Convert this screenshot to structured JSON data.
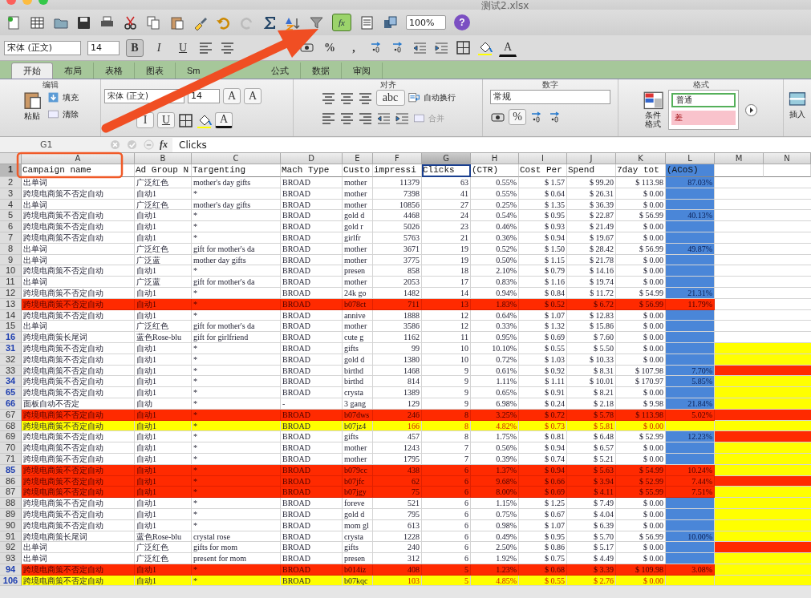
{
  "window": {
    "title": "测试2.xlsx"
  },
  "toolbar": {
    "formula_button": "fx",
    "zoom": "100%",
    "help": "?"
  },
  "format_bar": {
    "font": "宋体 (正文)",
    "size": "14",
    "bold": "B",
    "italic": "I",
    "underline": "U",
    "percent": "%",
    "comma": ",",
    "font_color": "A"
  },
  "ribbon_tabs": [
    {
      "label": "开始",
      "selected": true
    },
    {
      "label": "布局",
      "selected": false
    },
    {
      "label": "表格",
      "selected": false
    },
    {
      "label": "图表",
      "selected": false
    },
    {
      "label": "Sm",
      "selected": false
    },
    {
      "label": "公式",
      "selected": false
    },
    {
      "label": "数据",
      "selected": false
    },
    {
      "label": "审阅",
      "selected": false
    }
  ],
  "ribbon": {
    "edit": {
      "title": "编辑",
      "paste": "粘贴",
      "fill": "填充",
      "clear": "清除"
    },
    "font": {
      "name": "宋体 (正文)",
      "size": "14",
      "grow": "A",
      "shrink": "A",
      "italic": "I",
      "underline": "U",
      "font_color": "A"
    },
    "align": {
      "title": "对齐",
      "orientation": "abc",
      "wrap": "自动换行",
      "merge": "合并"
    },
    "number": {
      "title": "数字",
      "format": "常规",
      "percent": "%"
    },
    "styles": {
      "title": "格式",
      "conditional_1": "条件",
      "conditional_2": "格式",
      "normal": "普通",
      "bad": "差"
    },
    "insert": "插入"
  },
  "formula_bar": {
    "cell": "G1",
    "fx": "fx",
    "value": "Clicks"
  },
  "sheet": {
    "columns": [
      {
        "letter": "A",
        "selected": false
      },
      {
        "letter": "B",
        "selected": false
      },
      {
        "letter": "C",
        "selected": false
      },
      {
        "letter": "D",
        "selected": false
      },
      {
        "letter": "E",
        "selected": false
      },
      {
        "letter": "F",
        "selected": false
      },
      {
        "letter": "G",
        "selected": true
      },
      {
        "letter": "H",
        "selected": false
      },
      {
        "letter": "I",
        "selected": false
      },
      {
        "letter": "J",
        "selected": false
      },
      {
        "letter": "K",
        "selected": false
      },
      {
        "letter": "L",
        "selected": false,
        "color": "#4a86d8"
      },
      {
        "letter": "M",
        "selected": false
      },
      {
        "letter": "N",
        "selected": false
      }
    ],
    "header_row": {
      "number": "1",
      "cells": [
        "Campaign name",
        "Ad Group N",
        "Targenting",
        "Mach Type",
        "Custo",
        "impressi",
        "Clicks",
        "(CTR)",
        "Cost Per",
        "Spend",
        "7day tot",
        "(ACoS)"
      ]
    },
    "rows": [
      {
        "number": "2",
        "number_blue": false,
        "cells": [
          "出单词",
          "广泛红色",
          "mother's day gifts",
          "BROAD",
          "mother",
          "11379",
          "63",
          "0.55%",
          "$ 1.57",
          "$ 99.20",
          "$ 113.98",
          "87.03%"
        ]
      },
      {
        "number": "3",
        "number_blue": false,
        "cells": [
          "跨境电商策不否定自动",
          "自动1",
          "*",
          "BROAD",
          "mother",
          "7398",
          "41",
          "0.55%",
          "$ 0.64",
          "$ 26.31",
          "$ 0.00"
        ]
      },
      {
        "number": "4",
        "number_blue": false,
        "cells": [
          "出单词",
          "广泛红色",
          "mother's day gifts",
          "BROAD",
          "mother",
          "10856",
          "27",
          "0.25%",
          "$ 1.35",
          "$ 36.39",
          "$ 0.00"
        ]
      },
      {
        "number": "5",
        "number_blue": false,
        "cells": [
          "跨境电商策不否定自动",
          "自动1",
          "*",
          "BROAD",
          "gold d",
          "4468",
          "24",
          "0.54%",
          "$ 0.95",
          "$ 22.87",
          "$ 56.99",
          "40.13%"
        ]
      },
      {
        "number": "6",
        "number_blue": false,
        "cells": [
          "跨境电商策不否定自动",
          "自动1",
          "*",
          "BROAD",
          "gold r",
          "5026",
          "23",
          "0.46%",
          "$ 0.93",
          "$ 21.49",
          "$ 0.00"
        ]
      },
      {
        "number": "7",
        "number_blue": false,
        "cells": [
          "跨境电商策不否定自动",
          "自动1",
          "*",
          "BROAD",
          "girlfr",
          "5763",
          "21",
          "0.36%",
          "$ 0.94",
          "$ 19.67",
          "$ 0.00"
        ]
      },
      {
        "number": "8",
        "number_blue": false,
        "cells": [
          "出单词",
          "广泛红色",
          "gift for mother's da",
          "BROAD",
          "mother",
          "3671",
          "19",
          "0.52%",
          "$ 1.50",
          "$ 28.42",
          "$ 56.99",
          "49.87%"
        ]
      },
      {
        "number": "9",
        "number_blue": false,
        "cells": [
          "出单词",
          "广泛蓝",
          "mother day gifts",
          "BROAD",
          "mother",
          "3775",
          "19",
          "0.50%",
          "$ 1.15",
          "$ 21.78",
          "$ 0.00"
        ]
      },
      {
        "number": "10",
        "number_blue": false,
        "cells": [
          "跨境电商策不否定自动",
          "自动1",
          "*",
          "BROAD",
          "presen",
          "858",
          "18",
          "2.10%",
          "$ 0.79",
          "$ 14.16",
          "$ 0.00"
        ]
      },
      {
        "number": "11",
        "number_blue": false,
        "cells": [
          "出单词",
          "广泛蓝",
          "gift for mother's da",
          "BROAD",
          "mother",
          "2053",
          "17",
          "0.83%",
          "$ 1.16",
          "$ 19.74",
          "$ 0.00"
        ]
      },
      {
        "number": "12",
        "number_blue": false,
        "cells": [
          "跨境电商策不否定自动",
          "自动1",
          "*",
          "BROAD",
          "24k go",
          "1482",
          "14",
          "0.94%",
          "$ 0.84",
          "$ 11.72",
          "$ 54.99",
          "21.31%"
        ]
      },
      {
        "number": "13",
        "number_blue": false,
        "color": "#ff2a00",
        "cells": [
          "跨境电商策不否定自动",
          "自动1",
          "*",
          "BROAD",
          "b078ct",
          "711",
          "13",
          "1.83%",
          "$ 0.52",
          "$ 6.72",
          "$ 56.99",
          "11.79%"
        ]
      },
      {
        "number": "14",
        "number_blue": false,
        "cells": [
          "跨境电商策不否定自动",
          "自动1",
          "*",
          "BROAD",
          "annive",
          "1888",
          "12",
          "0.64%",
          "$ 1.07",
          "$ 12.83",
          "$ 0.00"
        ]
      },
      {
        "number": "15",
        "number_blue": false,
        "cells": [
          "出单词",
          "广泛红色",
          "gift for mother's da",
          "BROAD",
          "mother",
          "3586",
          "12",
          "0.33%",
          "$ 1.32",
          "$ 15.86",
          "$ 0.00"
        ]
      },
      {
        "number": "16",
        "number_blue": true,
        "cells": [
          "跨境电商策长尾词",
          "蓝色Rose-blu",
          "gift for girlfriend",
          "BROAD",
          "cute g",
          "1162",
          "11",
          "0.95%",
          "$ 0.69",
          "$ 7.60",
          "$ 0.00"
        ]
      },
      {
        "number": "31",
        "number_blue": true,
        "side": {
          "color": "#ffff00"
        },
        "cells": [
          "跨境电商策不否定自动",
          "自动1",
          "*",
          "BROAD",
          "gifts",
          "99",
          "10",
          "10.10%",
          "$ 0.55",
          "$ 5.50",
          "$ 0.00"
        ]
      },
      {
        "number": "32",
        "number_blue": false,
        "side": {
          "color": "#ffff00"
        },
        "cells": [
          "跨境电商策不否定自动",
          "自动1",
          "*",
          "BROAD",
          "gold d",
          "1380",
          "10",
          "0.72%",
          "$ 1.03",
          "$ 10.33",
          "$ 0.00"
        ]
      },
      {
        "number": "33",
        "number_blue": false,
        "side": {
          "color": "#ff2a00"
        },
        "cells": [
          "跨境电商策不否定自动",
          "自动1",
          "*",
          "BROAD",
          "birthd",
          "1468",
          "9",
          "0.61%",
          "$ 0.92",
          "$ 8.31",
          "$ 107.98",
          "7.70%"
        ]
      },
      {
        "number": "34",
        "number_blue": true,
        "side": {
          "color": "#ffff00"
        },
        "cells": [
          "跨境电商策不否定自动",
          "自动1",
          "*",
          "BROAD",
          "birthd",
          "814",
          "9",
          "1.11%",
          "$ 1.11",
          "$ 10.01",
          "$ 170.97",
          "5.85%"
        ]
      },
      {
        "number": "65",
        "number_blue": true,
        "side": {
          "color": "#ffff00"
        },
        "cells": [
          "跨境电商策不否定自动",
          "自动1",
          "*",
          "BROAD",
          "crysta",
          "1389",
          "9",
          "0.65%",
          "$ 0.91",
          "$ 8.21",
          "$ 0.00"
        ]
      },
      {
        "number": "66",
        "number_blue": true,
        "side": {
          "color": "#ffff00"
        },
        "cells": [
          "面板自动不否定",
          "自动",
          "*",
          "-",
          "3 gang",
          "129",
          "9",
          "6.98%",
          "$ 0.24",
          "$ 2.18",
          "$ 9.98",
          "21.84%"
        ]
      },
      {
        "number": "67",
        "number_blue": false,
        "color": "#ff2a00",
        "side": {
          "color": "#ff2a00"
        },
        "cells": [
          "跨境电商策不否定自动",
          "自动1",
          "*",
          "BROAD",
          "b07dws",
          "246",
          "8",
          "3.25%",
          "$ 0.72",
          "$ 5.78",
          "$ 113.98",
          "5.02%"
        ]
      },
      {
        "number": "68",
        "number_blue": false,
        "color": "#ffff00",
        "side": {
          "color": "#ffff00"
        },
        "cells": [
          "跨境电商策不否定自动",
          "自动1",
          "*",
          "BROAD",
          "b07jz4",
          "166",
          "8",
          "4.82%",
          "$ 0.73",
          "$ 5.81",
          "$ 0.00"
        ]
      },
      {
        "number": "69",
        "number_blue": false,
        "side": {
          "color": "#ff2a00"
        },
        "cells": [
          "跨境电商策不否定自动",
          "自动1",
          "*",
          "BROAD",
          "gifts",
          "457",
          "8",
          "1.75%",
          "$ 0.81",
          "$ 6.48",
          "$ 52.99",
          "12.23%"
        ]
      },
      {
        "number": "70",
        "number_blue": false,
        "side": {
          "color": "#ffff00"
        },
        "cells": [
          "跨境电商策不否定自动",
          "自动1",
          "*",
          "BROAD",
          "mother",
          "1243",
          "7",
          "0.56%",
          "$ 0.94",
          "$ 6.57",
          "$ 0.00"
        ]
      },
      {
        "number": "71",
        "number_blue": false,
        "side": {
          "color": "#ffff00"
        },
        "cells": [
          "跨境电商策不否定自动",
          "自动1",
          "*",
          "BROAD",
          "mother",
          "1795",
          "7",
          "0.39%",
          "$ 0.74",
          "$ 5.21",
          "$ 0.00"
        ]
      },
      {
        "number": "85",
        "number_blue": true,
        "color": "#ff2a00",
        "side": {
          "color": "#ffff00"
        },
        "cells": [
          "跨境电商策不否定自动",
          "自动1",
          "*",
          "BROAD",
          "b079cc",
          "438",
          "6",
          "1.37%",
          "$ 0.94",
          "$ 5.63",
          "$ 54.99",
          "10.24%"
        ]
      },
      {
        "number": "86",
        "number_blue": false,
        "color": "#ff2a00",
        "side": {
          "color": "#ff2a00"
        },
        "cells": [
          "跨境电商策不否定自动",
          "自动1",
          "*",
          "BROAD",
          "b07jfc",
          "62",
          "6",
          "9.68%",
          "$ 0.66",
          "$ 3.94",
          "$ 52.99",
          "7.44%"
        ]
      },
      {
        "number": "87",
        "number_blue": false,
        "color": "#ff2a00",
        "side": {
          "color": "#ffff00"
        },
        "cells": [
          "跨境电商策不否定自动",
          "自动1",
          "*",
          "BROAD",
          "b07jgy",
          "75",
          "6",
          "8.00%",
          "$ 0.69",
          "$ 4.11",
          "$ 55.99",
          "7.51%"
        ]
      },
      {
        "number": "88",
        "number_blue": false,
        "side": {
          "color": "#ffff00"
        },
        "cells": [
          "跨境电商策不否定自动",
          "自动1",
          "*",
          "BROAD",
          "foreve",
          "521",
          "6",
          "1.15%",
          "$ 1.25",
          "$ 7.49",
          "$ 0.00"
        ]
      },
      {
        "number": "89",
        "number_blue": false,
        "side": {
          "color": "#ffff00"
        },
        "cells": [
          "跨境电商策不否定自动",
          "自动1",
          "*",
          "BROAD",
          "gold d",
          "795",
          "6",
          "0.75%",
          "$ 0.67",
          "$ 4.04",
          "$ 0.00"
        ]
      },
      {
        "number": "90",
        "number_blue": false,
        "side": {
          "color": "#ffff00"
        },
        "cells": [
          "跨境电商策不否定自动",
          "自动1",
          "*",
          "BROAD",
          "mom gl",
          "613",
          "6",
          "0.98%",
          "$ 1.07",
          "$ 6.39",
          "$ 0.00"
        ]
      },
      {
        "number": "91",
        "number_blue": false,
        "side": {
          "color": "#ffff00"
        },
        "cells": [
          "跨境电商策长尾词",
          "蓝色Rose-blu",
          "crystal rose",
          "BROAD",
          "crysta",
          "1228",
          "6",
          "0.49%",
          "$ 0.95",
          "$ 5.70",
          "$ 56.99",
          "10.00%"
        ]
      },
      {
        "number": "92",
        "number_blue": false,
        "side": {
          "color": "#ff2a00"
        },
        "cells": [
          "出单词",
          "广泛红色",
          "gifts for mom",
          "BROAD",
          "gifts",
          "240",
          "6",
          "2.50%",
          "$ 0.86",
          "$ 5.17",
          "$ 0.00"
        ]
      },
      {
        "number": "93",
        "number_blue": false,
        "side": {
          "color": "#ffff00"
        },
        "cells": [
          "出单词",
          "广泛红色",
          "present for mom",
          "BROAD",
          "presen",
          "312",
          "6",
          "1.92%",
          "$ 0.75",
          "$ 4.49",
          "$ 0.00"
        ]
      },
      {
        "number": "94",
        "number_blue": true,
        "color": "#ff2a00",
        "side": {
          "color": "#ffff00"
        },
        "cells": [
          "跨境电商策不否定自动",
          "自动1",
          "*",
          "BROAD",
          "b014iz",
          "408",
          "5",
          "1.23%",
          "$ 0.68",
          "$ 3.39",
          "$ 109.98",
          "3.08%"
        ]
      },
      {
        "number": "106",
        "number_blue": true,
        "color": "#ffff00",
        "side": {
          "color": "#ffff00"
        },
        "cells": [
          "跨境电商策不否定自动",
          "自动1",
          "*",
          "BROAD",
          "b07kqc",
          "103",
          "5",
          "4.85%",
          "$ 0.55",
          "$ 2.76",
          "$ 0.00"
        ]
      }
    ]
  }
}
